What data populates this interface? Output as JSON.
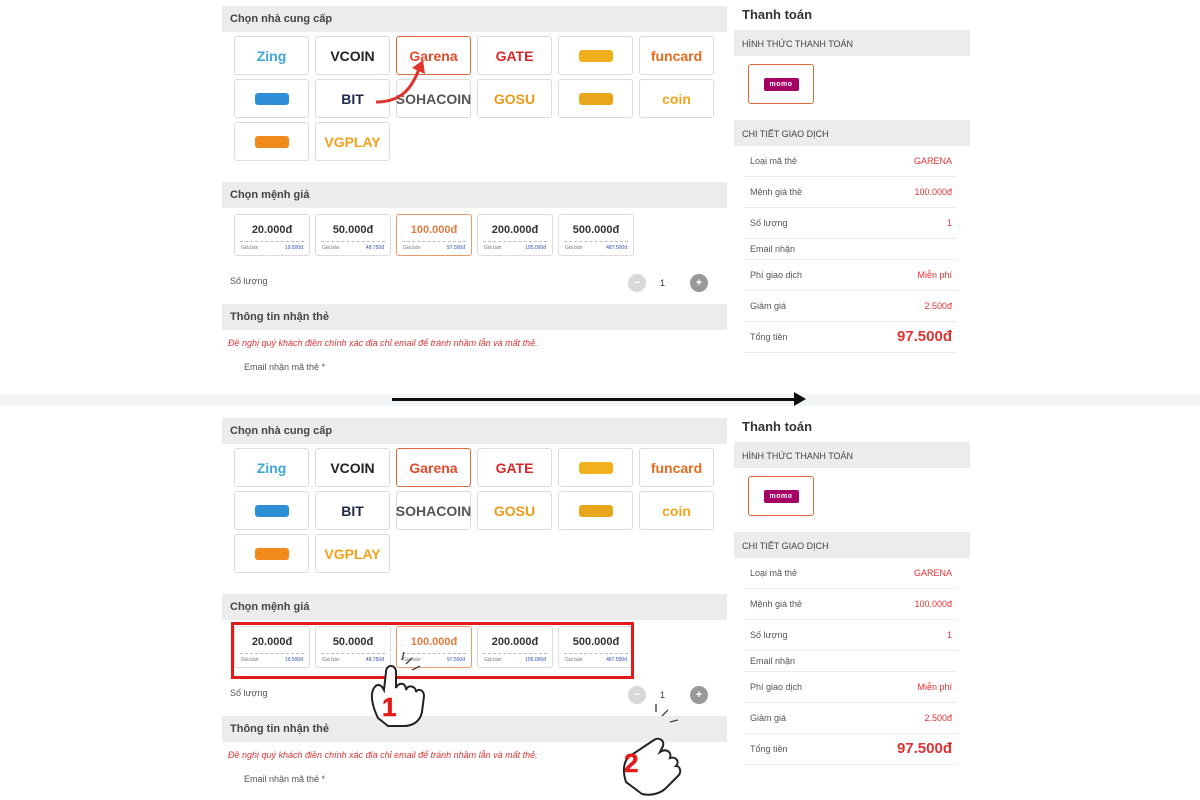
{
  "providers_title": "Chọn nhà cung cấp",
  "providers": [
    {
      "name": "Zing",
      "color": "#3fa7d6",
      "icon": "zing-logo"
    },
    {
      "name": "VCOIN",
      "color": "#222222",
      "icon": "vcoin-logo"
    },
    {
      "name": "Garena",
      "color": "#e24a2b",
      "icon": "garena-logo",
      "selected": true
    },
    {
      "name": "GATE",
      "color": "#d8282a",
      "icon": "gate-logo"
    },
    {
      "name": "",
      "color": "#f1b11c",
      "icon": "carrier-logo"
    },
    {
      "name": "funcard",
      "color": "#e56b1f",
      "icon": "funcard-logo"
    },
    {
      "name": "",
      "color": "#2f8fd6",
      "icon": "appota-logo"
    },
    {
      "name": "BIT",
      "color": "#1f2a4d",
      "icon": "bit-logo"
    },
    {
      "name": "SOHACOIN",
      "color": "#555555",
      "icon": "sohacoin-logo"
    },
    {
      "name": "GOSU",
      "color": "#e89b16",
      "icon": "gosu-logo"
    },
    {
      "name": "",
      "color": "#e8a61a",
      "icon": "oncash-logo"
    },
    {
      "name": "coin",
      "color": "#f2a41b",
      "icon": "scoin-logo"
    },
    {
      "name": "",
      "color": "#f08a1a",
      "icon": "zzgame-logo"
    },
    {
      "name": "VGPLAY",
      "color": "#f4a11a",
      "icon": "vgplay-logo"
    }
  ],
  "denoms_title": "Chọn mệnh giá",
  "denoms": [
    {
      "amount": "20.000đ",
      "label": "Giá bán",
      "price": "19.500đ"
    },
    {
      "amount": "50.000đ",
      "label": "Giá bán",
      "price": "48.750đ"
    },
    {
      "amount": "100.000đ",
      "label": "Giá bán",
      "price": "97.500đ",
      "selected": true
    },
    {
      "amount": "200.000đ",
      "label": "Giá bán",
      "price": "195.000đ"
    },
    {
      "amount": "500.000đ",
      "label": "Giá bán",
      "price": "487.500đ"
    }
  ],
  "quantity": {
    "label": "Số lượng",
    "value": "1",
    "minus": "−",
    "plus": "+"
  },
  "recipient": {
    "title": "Thông tin nhận thẻ",
    "notice": "Đề nghị quý khách điền chính xác địa chỉ email để tránh nhầm lẫn và mất thẻ.",
    "email_label": "Email nhận mã thẻ *"
  },
  "payment": {
    "title": "Thanh toán",
    "method_title": "HÌNH THỨC THANH TOÁN",
    "method": "momo",
    "details_title": "CHI TIẾT GIAO DỊCH",
    "rows": [
      {
        "k": "Loại mã thẻ",
        "v": "GARENA"
      },
      {
        "k": "Mệnh giá thẻ",
        "v": "100.000đ"
      },
      {
        "k": "Số lượng",
        "v": "1"
      },
      {
        "k": "Email nhận",
        "v": ""
      },
      {
        "k": "Phí giao dịch",
        "v": "Miễn phí"
      },
      {
        "k": "Giảm giá",
        "v": "2.500đ"
      },
      {
        "k": "Tổng tiền",
        "v": "97.500đ"
      }
    ]
  },
  "steps": [
    "1",
    "2"
  ],
  "colors": {
    "accent": "#d96b3c",
    "highlight": "#e21a1a",
    "price_blue": "#2d4fb8",
    "momo": "#a50064"
  }
}
